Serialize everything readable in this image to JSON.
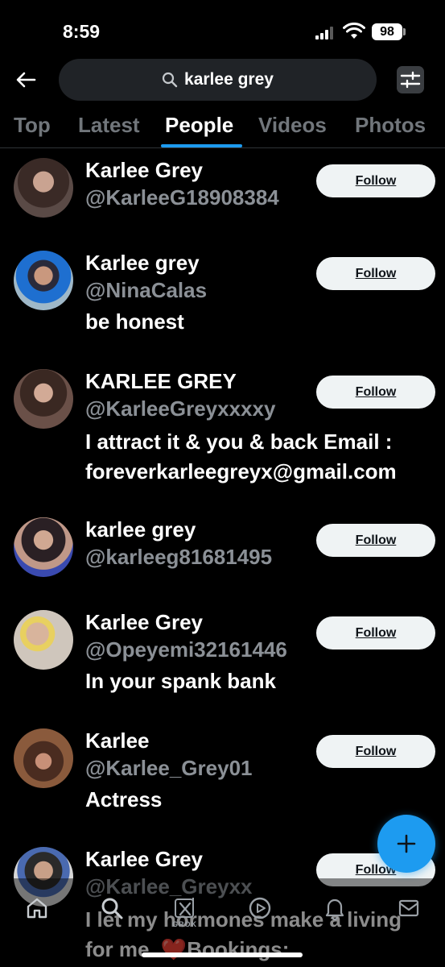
{
  "status_bar": {
    "time": "8:59",
    "battery": "98"
  },
  "search": {
    "query": "karlee grey"
  },
  "tabs": [
    {
      "label": "Top"
    },
    {
      "label": "Latest"
    },
    {
      "label": "People"
    },
    {
      "label": "Videos"
    },
    {
      "label": "Photos"
    }
  ],
  "results": [
    {
      "name": "Karlee Grey",
      "handle": "@KarleeG18908384",
      "bio": "",
      "follow_label": "Follow"
    },
    {
      "name": "Karlee grey",
      "handle": "@NinaCalas",
      "bio": "be honest",
      "follow_label": "Follow"
    },
    {
      "name": "KARLEE GREY",
      "handle": "@KarleeGreyxxxxy",
      "bio_line1": "I attract it & you & back Email :",
      "bio_line2": "foreverkarleegreyx@gmail.com",
      "follow_label": "Follow"
    },
    {
      "name": "karlee grey",
      "handle": "@karleeg81681495",
      "bio": "",
      "follow_label": "Follow"
    },
    {
      "name": "Karlee Grey",
      "handle": "@Opeyemi32161446",
      "bio": "In your spank bank",
      "follow_label": "Follow"
    },
    {
      "name": "Karlee",
      "handle": "@Karlee_Grey01",
      "bio": "Actress",
      "follow_label": "Follow"
    },
    {
      "name": "Karlee Grey",
      "handle": "@Karlee_Greyxx",
      "bio_line1": "I let my hormones make a living",
      "bio_line2": "for me. ❤️Bookings:",
      "follow_label": "Follow"
    }
  ],
  "bottom_nav": {
    "grok_label": "GROK"
  },
  "colors": {
    "accent": "#1d9bf0",
    "background": "#000000",
    "secondary_text": "#71767b"
  }
}
